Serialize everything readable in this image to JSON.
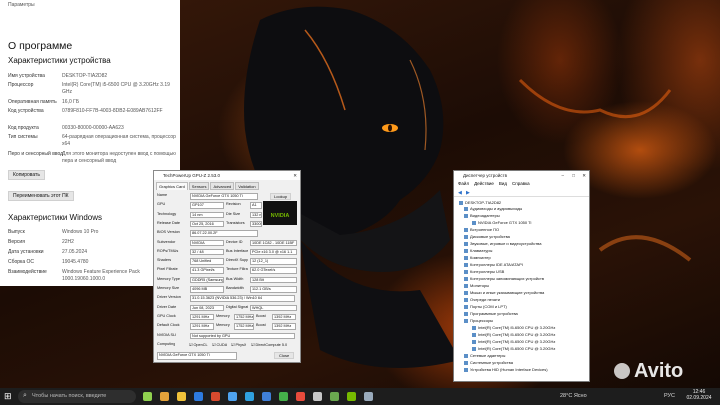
{
  "about": {
    "title": "О программе",
    "spec_heading": "Характеристики устройства",
    "device_specs": [
      {
        "label": "Имя устройства",
        "value": "DESKTOP-TIA2D82"
      },
      {
        "label": "Процессор",
        "value": "Intel(R) Core(TM) i5-6500 CPU @ 3.20GHz   3.19 GHz"
      },
      {
        "label": "Оперативная память",
        "value": "16,0 ГБ"
      },
      {
        "label": "Код устройства",
        "value": "0789F810-FF7B-4003-8DB2-E089AB7612FF"
      },
      {
        "label": "Код продукта",
        "value": "00330-80000-00000-AA623"
      },
      {
        "label": "Тип системы",
        "value": "64-разрядная операционная система, процессор x64"
      },
      {
        "label": "Перо и сенсорный ввод",
        "value": "Для этого монитора недоступен ввод с помощью пера и сенсорный ввод"
      }
    ],
    "copy_button": "Копировать",
    "rename_button": "Переименовать этот ПК",
    "win_heading": "Характеристики Windows",
    "win_specs": [
      {
        "label": "Выпуск",
        "value": "Windows 10 Pro"
      },
      {
        "label": "Версия",
        "value": "22H2"
      },
      {
        "label": "Дата установки",
        "value": "27.05.2024"
      },
      {
        "label": "Сборка ОС",
        "value": "19045.4780"
      },
      {
        "label": "Взаимодействие",
        "value": "Windows Feature Experience Pack 1000.19060.1000.0"
      }
    ]
  },
  "gpuz": {
    "title": "TechPowerUp GPU-Z 2.53.0",
    "tabs": [
      "Graphics Card",
      "Sensors",
      "Advanced",
      "Validation"
    ],
    "lookup": "Lookup",
    "logo": "NVIDIA",
    "rows": [
      {
        "label": "Name",
        "value": "NVIDIA GeForce GTX 1050 Ti"
      },
      {
        "label": "GPU",
        "value": "GP107",
        "l2": "Revision",
        "v2": "A1"
      },
      {
        "label": "Technology",
        "value": "14 nm",
        "l2": "Die Size",
        "v2": "132 mm²"
      },
      {
        "label": "Release Date",
        "value": "Oct 25, 2016",
        "l2": "Transistors",
        "v2": "3300M"
      },
      {
        "label": "BIOS Version",
        "value": "86.07.22.00.2F"
      },
      {
        "label": "Subvendor",
        "value": "NVIDIA",
        "l2": "Device ID",
        "v2": "10DE 1C82 - 10DE 11BF"
      },
      {
        "label": "ROPs/TMUs",
        "value": "32 / 48",
        "l2": "Bus Interface",
        "v2": "PCIe x16 3.0 @ x16 1.1"
      },
      {
        "label": "Shaders",
        "value": "768 Unified",
        "l2": "DirectX Support",
        "v2": "12 (12_1)"
      },
      {
        "label": "Pixel Fillrate",
        "value": "41.3 GPixel/s",
        "l2": "Texture Fillrate",
        "v2": "62.0 GTexel/s"
      },
      {
        "label": "Memory Type",
        "value": "GDDR5 (Samsung)",
        "l2": "Bus Width",
        "v2": "128 Bit"
      },
      {
        "label": "Memory Size",
        "value": "4096 MB",
        "l2": "Bandwidth",
        "v2": "112.1 GB/s"
      },
      {
        "label": "Driver Version",
        "value": "31.0.15.3623 (NVIDIA 536.23) / Win10 64"
      },
      {
        "label": "Driver Date",
        "value": "Jun 08, 2023",
        "l2": "Digital Signature",
        "v2": "WHQL"
      },
      {
        "label": "GPU Clock",
        "value": "1291 MHz",
        "l2": "Memory",
        "v2": "1752 MHz",
        "l3": "Boost",
        "v3": "1392 MHz"
      },
      {
        "label": "Default Clock",
        "value": "1291 MHz",
        "l2": "Memory",
        "v2": "1752 MHz",
        "l3": "Boost",
        "v3": "1392 MHz"
      },
      {
        "label": "NVIDIA SLI",
        "value": "Not supported by GPU"
      }
    ],
    "computing_label": "Computing",
    "computing": [
      "OpenCL",
      "CUDA",
      "PhysX",
      "DirectCompute 5.0"
    ],
    "selected_card": "NVIDIA GeForce GTX 1050 Ti",
    "close": "Close"
  },
  "devmgr": {
    "title": "Диспетчер устройств",
    "menu": [
      "Файл",
      "Действие",
      "Вид",
      "Справка"
    ],
    "root": "DESKTOP-TIA2D82",
    "items": [
      {
        "text": "Аудиовходы и аудиовыходы",
        "level": 1
      },
      {
        "text": "Видеоадаптеры",
        "level": 1
      },
      {
        "text": "NVIDIA GeForce GTX 1050 Ti",
        "level": 2
      },
      {
        "text": "Встроенное ПО",
        "level": 1
      },
      {
        "text": "Дисковые устройства",
        "level": 1
      },
      {
        "text": "Звуковые, игровые и видеоустройства",
        "level": 1
      },
      {
        "text": "Клавиатуры",
        "level": 1
      },
      {
        "text": "Компьютер",
        "level": 1
      },
      {
        "text": "Контроллеры IDE ATA/ATAPI",
        "level": 1
      },
      {
        "text": "Контроллеры USB",
        "level": 1
      },
      {
        "text": "Контроллеры запоминающих устройств",
        "level": 1
      },
      {
        "text": "Мониторы",
        "level": 1
      },
      {
        "text": "Мыши и иные указывающие устройства",
        "level": 1
      },
      {
        "text": "Очереди печати",
        "level": 1
      },
      {
        "text": "Порты (COM и LPT)",
        "level": 1
      },
      {
        "text": "Программные устройства",
        "level": 1
      },
      {
        "text": "Процессоры",
        "level": 1
      },
      {
        "text": "Intel(R) Core(TM) i5-6500 CPU @ 3.20GHz",
        "level": 2
      },
      {
        "text": "Intel(R) Core(TM) i5-6500 CPU @ 3.20GHz",
        "level": 2
      },
      {
        "text": "Intel(R) Core(TM) i5-6500 CPU @ 3.20GHz",
        "level": 2
      },
      {
        "text": "Intel(R) Core(TM) i5-6500 CPU @ 3.20GHz",
        "level": 2
      },
      {
        "text": "Сетевые адаптеры",
        "level": 1
      },
      {
        "text": "Системные устройства",
        "level": 1
      },
      {
        "text": "Устройства HID (Human Interface Devices)",
        "level": 1
      }
    ]
  },
  "taskbar": {
    "search_placeholder": "Чтобы начать поиск, введите",
    "weather": "28°C Ясно",
    "lang": "РУС",
    "time": "12:46",
    "date": "02.09.2024"
  },
  "watermark": "Avito"
}
